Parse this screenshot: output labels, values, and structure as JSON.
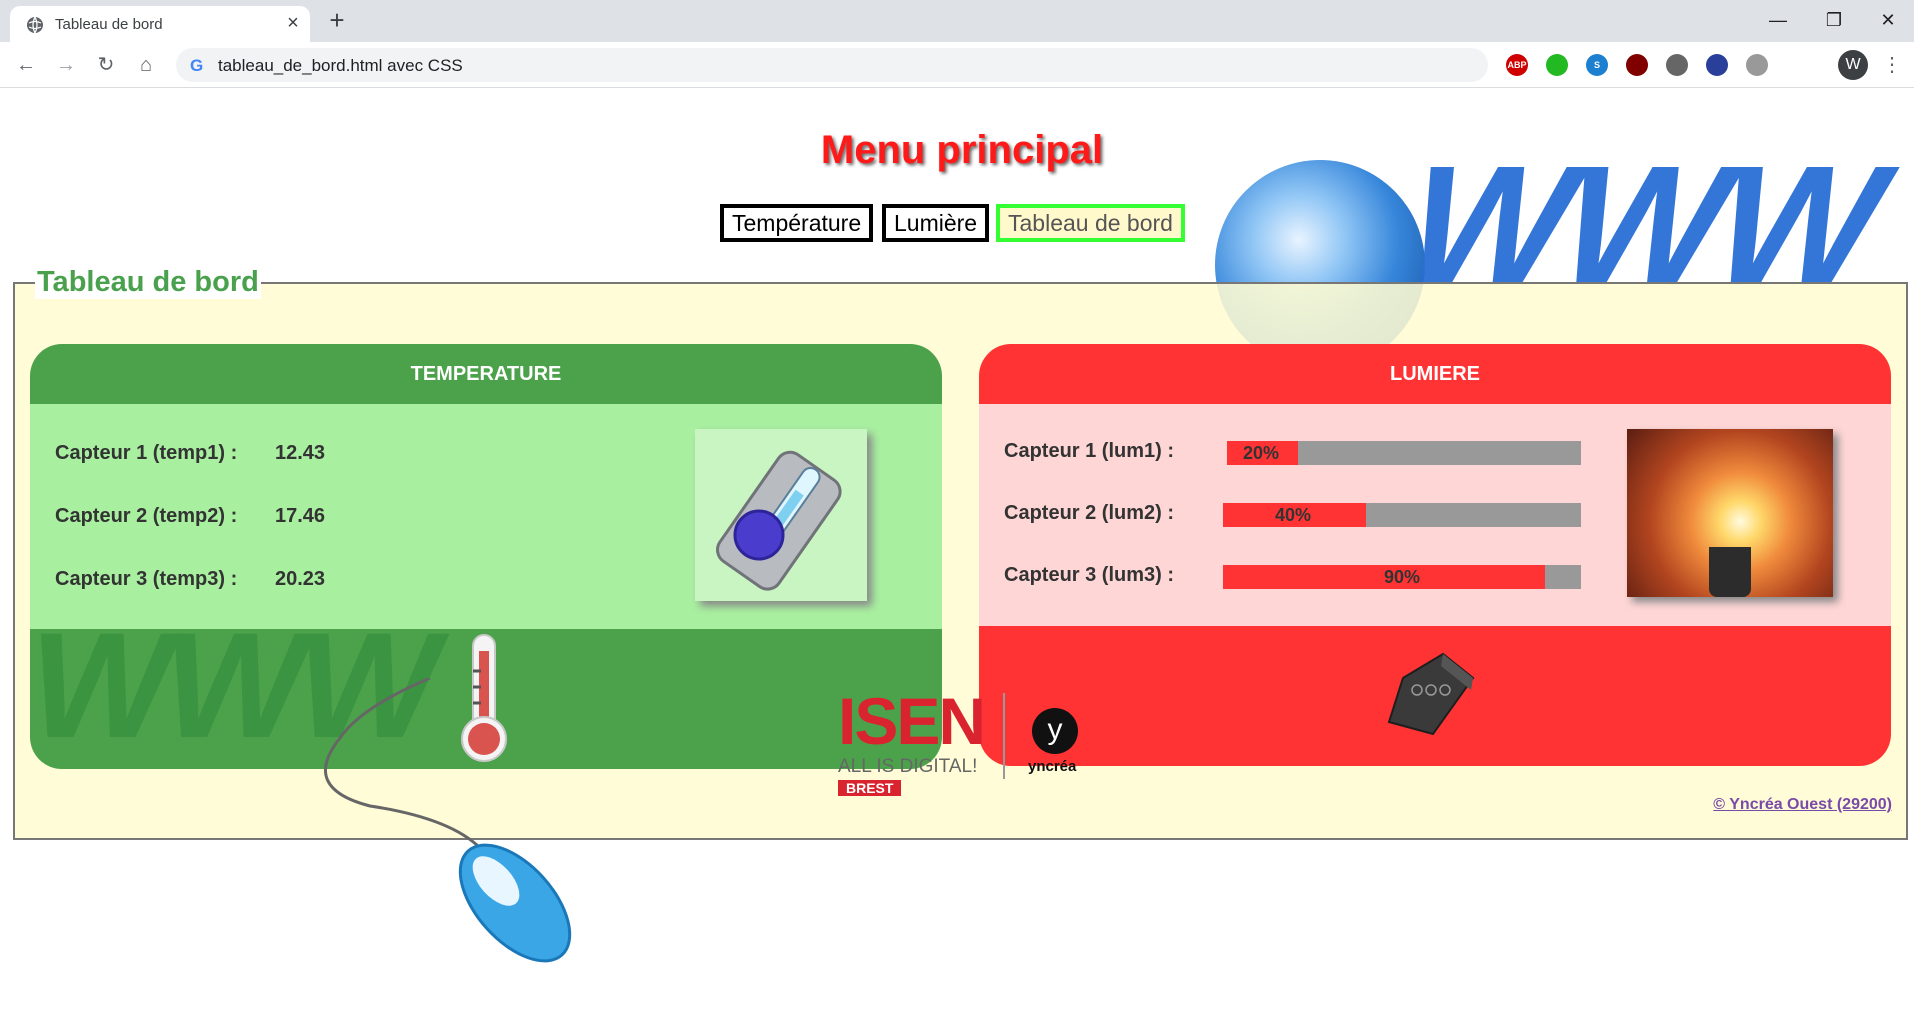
{
  "browser": {
    "tab_title": "Tableau de bord",
    "url": "tableau_de_bord.html avec CSS",
    "profile_initial": "W",
    "extensions": [
      {
        "name": "abp-icon",
        "label": "ABP",
        "color": "#d00000"
      },
      {
        "name": "evernote-icon",
        "label": "",
        "color": "#22b922"
      },
      {
        "name": "skype-icon",
        "label": "S",
        "color": "#1c7fd0"
      },
      {
        "name": "ublock-icon",
        "label": "",
        "color": "#800000"
      },
      {
        "name": "circle-icon",
        "label": "",
        "color": "#666666"
      },
      {
        "name": "password-icon",
        "label": "",
        "color": "#2a3f9a"
      },
      {
        "name": "pdf-icon",
        "label": "",
        "color": "#999999"
      }
    ]
  },
  "page": {
    "menu_title": "Menu principal",
    "menu_links": [
      {
        "label": "Température",
        "active": false
      },
      {
        "label": "Lumière",
        "active": false
      },
      {
        "label": "Tableau de bord",
        "active": true
      }
    ],
    "legend": "Tableau de bord",
    "copyright": "© Yncréa Ouest (29200)"
  },
  "temperature": {
    "title": "TEMPERATURE",
    "rows": [
      {
        "label": "Capteur 1 (temp1) :",
        "value": "12.43"
      },
      {
        "label": "Capteur 2 (temp2) :",
        "value": "17.46"
      },
      {
        "label": "Capteur 3 (temp3) :",
        "value": "20.23"
      }
    ]
  },
  "lumiere": {
    "title": "LUMIERE",
    "rows": [
      {
        "label": "Capteur 1 (lum1) :",
        "percent": 20,
        "text": "20%"
      },
      {
        "label": "Capteur 2 (lum2) :",
        "percent": 40,
        "text": "40%"
      },
      {
        "label": "Capteur 3 (lum3) :",
        "percent": 90,
        "text": "90%"
      }
    ]
  },
  "logos": {
    "isen": "ISEN",
    "isen_tagline": "ALL IS DIGITAL!",
    "isen_city": "BREST",
    "yncrea_mark": "y",
    "yncrea": "yncréa"
  },
  "colors": {
    "menu_title": "#ff1a1a",
    "legend": "#4aa14d",
    "temp_header": "#4ca24a",
    "temp_body": "#a8f0a0",
    "lum_header": "#ff3333",
    "lum_body": "#ffd6d6",
    "active_link_border": "#33ff33"
  }
}
